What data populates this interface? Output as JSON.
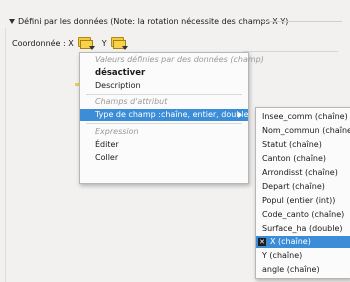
{
  "group": {
    "title": "Défini par les données (Note: la rotation nécessite des champs X Y)",
    "coord_label": "Coordonnée : X",
    "y_label": "Y"
  },
  "context_menu": {
    "items": [
      {
        "label": "Valeurs définies par des données (champ)",
        "kind": "header"
      },
      {
        "label": "désactiver",
        "kind": "bold"
      },
      {
        "label": "Description",
        "kind": "item"
      },
      {
        "label": "Champs d'attribut",
        "kind": "header"
      },
      {
        "label": "Type de champ :chaîne, entier, double",
        "kind": "highlighted"
      },
      {
        "label": "Expression",
        "kind": "header"
      },
      {
        "label": "Éditer",
        "kind": "item"
      },
      {
        "label": "Coller",
        "kind": "item"
      }
    ]
  },
  "submenu": {
    "items": [
      {
        "label": "Insee_comm    (chaîne)"
      },
      {
        "label": "Nom_commun   (chaîne)"
      },
      {
        "label": "Statut   (chaîne)"
      },
      {
        "label": "Canton   (chaîne)"
      },
      {
        "label": "Arrondisst   (chaîne)"
      },
      {
        "label": "Depart   (chaîne)"
      },
      {
        "label": "Popul   (entier (int))"
      },
      {
        "label": "Code_canto   (chaîne)"
      },
      {
        "label": "Surface_ha   (double)"
      },
      {
        "label": "X   (chaîne)",
        "selected": true
      },
      {
        "label": "Y   (chaîne)"
      },
      {
        "label": "angle   (chaîne)"
      }
    ],
    "check_glyph": "✕"
  }
}
